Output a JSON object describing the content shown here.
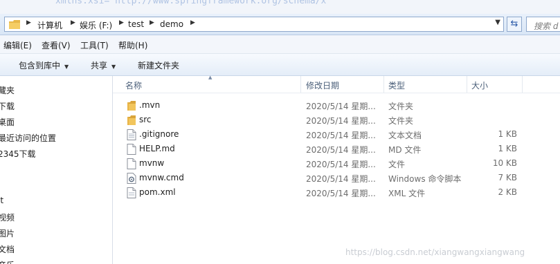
{
  "code_strip_text": "xmlns:xsi=\"http://www.springframework.org/schema/x\"",
  "address": {
    "segments": [
      "计算机",
      "娱乐 (F:)",
      "test",
      "demo"
    ],
    "search_placeholder": "搜索 d"
  },
  "menu": {
    "items": [
      "编辑(E)",
      "查看(V)",
      "工具(T)",
      "帮助(H)"
    ]
  },
  "toolbar": {
    "items": [
      {
        "label": "包含到库中",
        "dropdown": true
      },
      {
        "label": "共享",
        "dropdown": true
      },
      {
        "label": "新建文件夹",
        "dropdown": false
      }
    ]
  },
  "nav": {
    "items": [
      "藏夹",
      "下载",
      "桌面",
      "最近访问的位置",
      "2345下载",
      "",
      "it",
      "视频",
      "图片",
      "文档",
      "音乐"
    ]
  },
  "columns": {
    "name": "名称",
    "date": "修改日期",
    "type": "类型",
    "size": "大小"
  },
  "files": [
    {
      "name": ".mvn",
      "date": "2020/5/14 星期...",
      "type": "文件夹",
      "size": "",
      "icon": "folder-icon"
    },
    {
      "name": "src",
      "date": "2020/5/14 星期...",
      "type": "文件夹",
      "size": "",
      "icon": "folder-icon"
    },
    {
      "name": ".gitignore",
      "date": "2020/5/14 星期...",
      "type": "文本文档",
      "size": "1 KB",
      "icon": "text-file-icon"
    },
    {
      "name": "HELP.md",
      "date": "2020/5/14 星期...",
      "type": "MD 文件",
      "size": "1 KB",
      "icon": "file-icon"
    },
    {
      "name": "mvnw",
      "date": "2020/5/14 星期...",
      "type": "文件",
      "size": "10 KB",
      "icon": "file-icon"
    },
    {
      "name": "mvnw.cmd",
      "date": "2020/5/14 星期...",
      "type": "Windows 命令脚本",
      "size": "7 KB",
      "icon": "cmd-file-icon"
    },
    {
      "name": "pom.xml",
      "date": "2020/5/14 星期...",
      "type": "XML 文件",
      "size": "2 KB",
      "icon": "xml-file-icon"
    }
  ],
  "watermark": "https://blog.csdn.net/xiangwangxiangwang",
  "colors": {
    "folder": "#e8b84a",
    "accent": "#2b5aa8"
  }
}
